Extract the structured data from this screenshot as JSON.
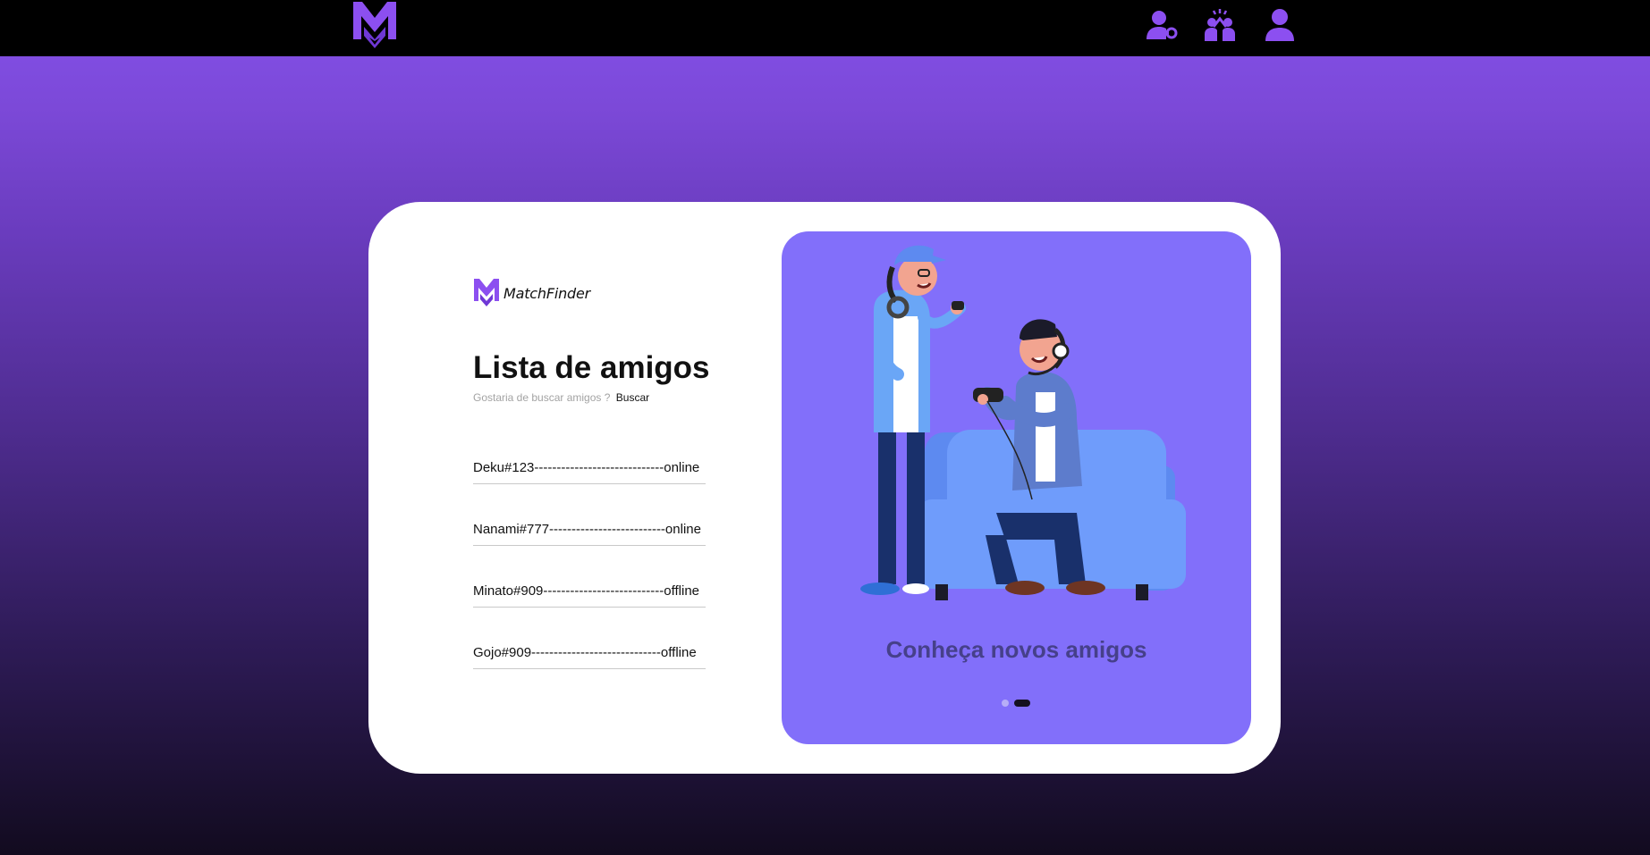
{
  "nav": {
    "logo_icon": "matchfinder-logo",
    "icons": [
      "user-key-icon",
      "friends-group-icon",
      "profile-icon"
    ],
    "accent_color": "#8c4ff0"
  },
  "card": {
    "brand_name": "MatchFinder",
    "title": "Lista de amigos",
    "subtitle_text": "Gostaria de buscar amigos ?",
    "subtitle_link": "Buscar",
    "friends": [
      "Deku#123-----------------------------online",
      "Nanami#777--------------------------online",
      "Minato#909---------------------------offline",
      "Gojo#909-----------------------------offline"
    ]
  },
  "carousel": {
    "caption": "Conheça novos amigos",
    "slide_count": 2,
    "active_slide": 2,
    "panel_color": "#826ffa"
  }
}
